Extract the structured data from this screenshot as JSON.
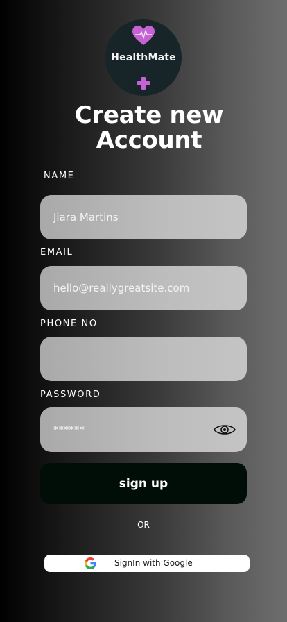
{
  "logo": {
    "brand": "HealthMate",
    "icons": [
      "heart-pulse-icon",
      "plus-icon"
    ],
    "colors": {
      "background": "#182528",
      "heart": "#c562d6",
      "plus": "#c562d6"
    }
  },
  "title": {
    "line1": "Create new",
    "line2": "Account"
  },
  "form": {
    "name": {
      "label": "NAME",
      "value": "Jiara Martins"
    },
    "email": {
      "label": "EMAIL",
      "value": "hello@reallygreatsite.com"
    },
    "phone": {
      "label": "PHONE NO",
      "value": ""
    },
    "password": {
      "label": "PASSWORD",
      "value": "******",
      "icon": "eye-icon"
    }
  },
  "signup_label": "sign up",
  "or_label": "OR",
  "google": {
    "label": "SignIn with Google",
    "icon": "google-icon"
  },
  "colors": {
    "signup_bg": "#000e07",
    "field_bg": "#bdbdbd"
  }
}
